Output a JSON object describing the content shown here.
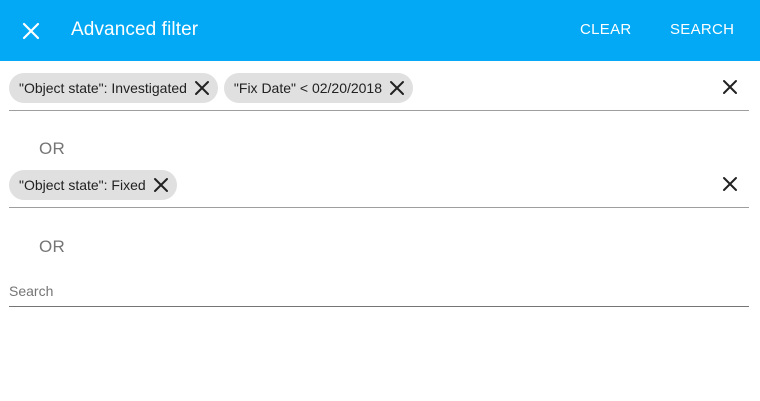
{
  "header": {
    "title": "Advanced filter",
    "clear_label": "CLEAR",
    "search_label": "SEARCH",
    "close_icon": "close-icon",
    "background_color": "#03a9f4"
  },
  "filter_groups": [
    {
      "chips": [
        {
          "label": "\"Object state\": Investigated"
        },
        {
          "label": "\"Fix Date\" < 02/20/2018"
        }
      ]
    },
    {
      "chips": [
        {
          "label": "\"Object state\": Fixed"
        }
      ]
    }
  ],
  "separators": [
    "OR",
    "OR"
  ],
  "search": {
    "placeholder": "Search",
    "value": ""
  }
}
